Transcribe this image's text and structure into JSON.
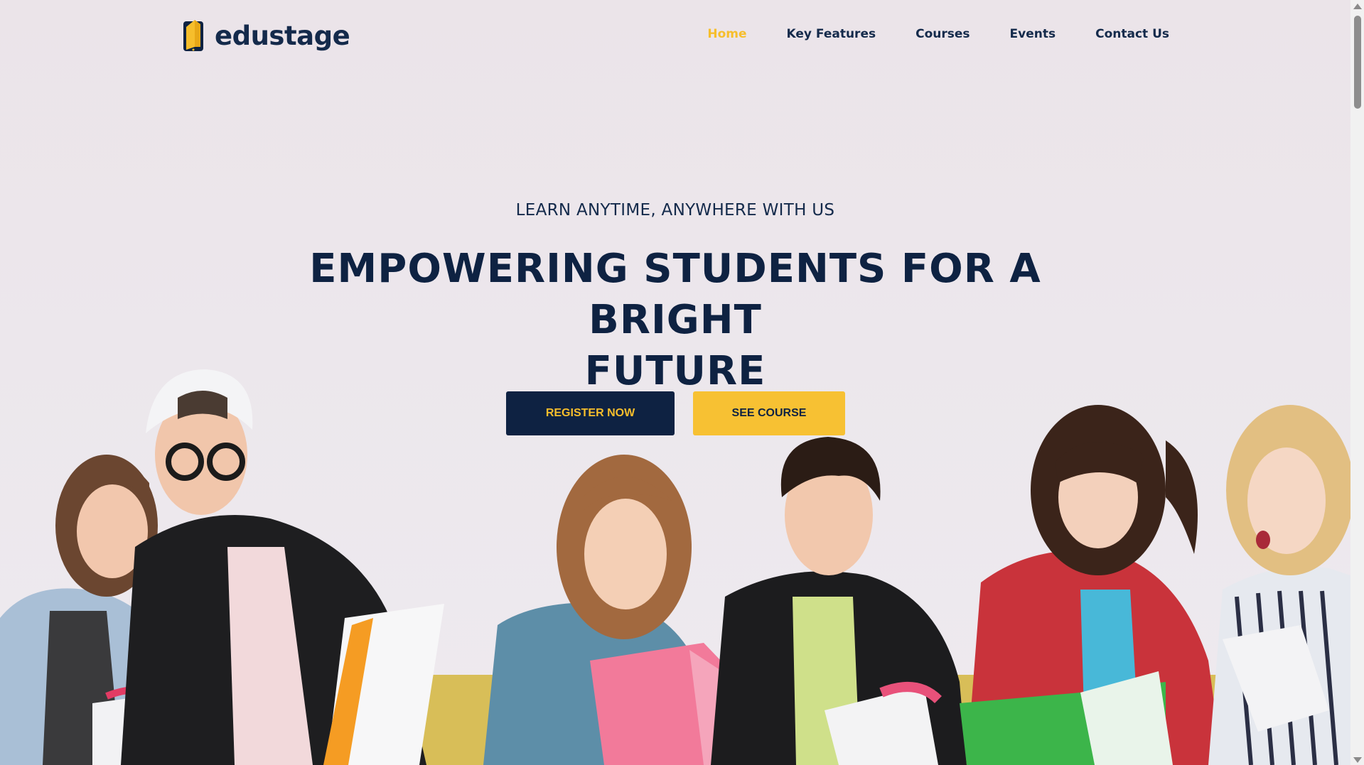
{
  "brand": {
    "name": "edustage"
  },
  "nav": {
    "items": [
      {
        "label": "Home",
        "active": true
      },
      {
        "label": "Key Features",
        "active": false
      },
      {
        "label": "Courses",
        "active": false
      },
      {
        "label": "Events",
        "active": false
      },
      {
        "label": "Contact Us",
        "active": false
      }
    ]
  },
  "hero": {
    "subtitle": "LEARN ANYTIME, ANYWHERE WITH US",
    "headline_line1": "EMPOWERING STUDENTS FOR A BRIGHT",
    "headline_line2": "FUTURE",
    "register_label": "REGISTER NOW",
    "course_label": "SEE COURSE"
  },
  "colors": {
    "navy": "#0e2242",
    "accent_yellow": "#f6be2c",
    "background": "#ece7ec"
  },
  "icons": {
    "logo": "book-tablet-icon",
    "scroll_up": "triangle-up-icon",
    "scroll_down": "triangle-down-icon"
  }
}
